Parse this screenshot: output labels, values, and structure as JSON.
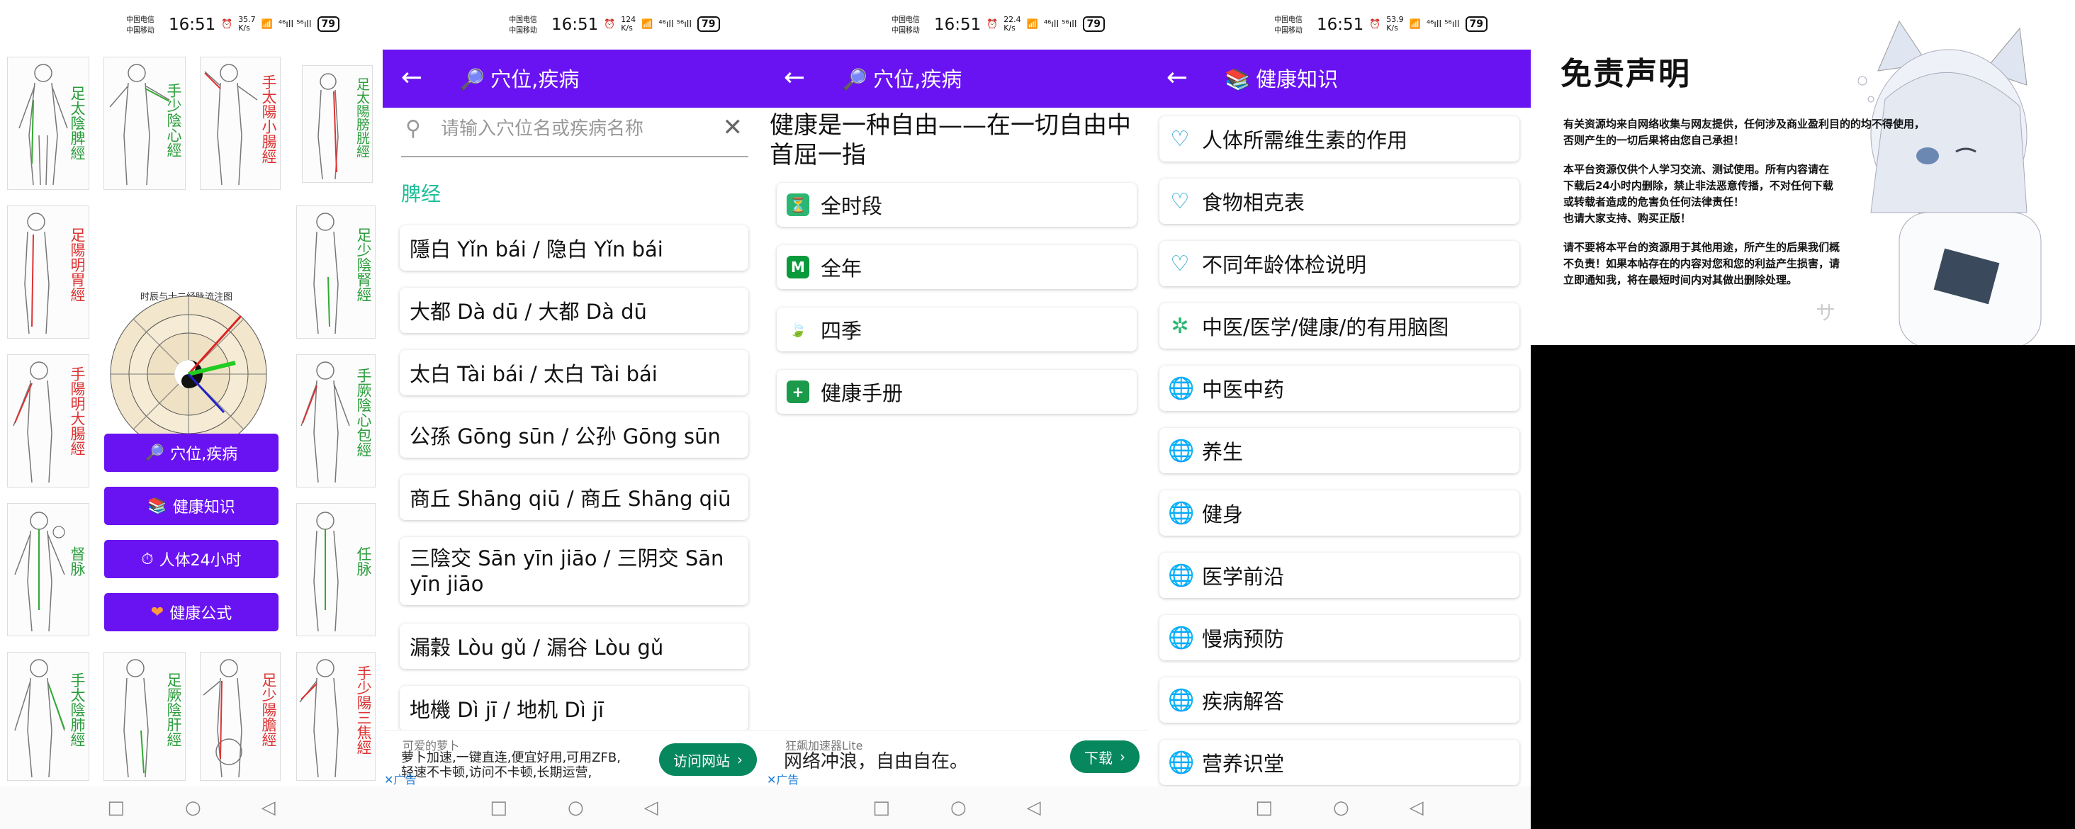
{
  "status": {
    "carrier1": "中国电信",
    "carrier2": "中国移动",
    "time": "16:51",
    "speeds": [
      "35.7\nK/s",
      "124\nK/s",
      "22.4\nK/s",
      "53.9\nK/s"
    ],
    "signal": "⁴⁶ıll ⁵⁶ıll",
    "battery": "79"
  },
  "panel1": {
    "meridians": [
      "足太陰脾經",
      "手少陰心經",
      "手太陽小腸經",
      "足太陽膀胱經",
      "足陽明胃經",
      "足少陰腎經",
      "手陽明大腸經",
      "手厥陰心包經",
      "督脉",
      "任脉",
      "手太陰肺經",
      "足厥陰肝經",
      "足少陽膽經",
      "手少陽三焦經"
    ],
    "clock_title": "时辰与十二经脉流注图",
    "buttons": [
      "穴位,疾病",
      "健康知识",
      "人体24小时",
      "健康公式"
    ]
  },
  "panel2": {
    "title": "穴位,疾病",
    "search_placeholder": "请输入穴位名或疾病名称",
    "section": "脾经",
    "items": [
      "隱白 Yǐn bái / 隐白 Yǐn bái",
      "大都 Dà dū / 大都 Dà dū",
      "太白 Tài bái / 太白 Tài bái",
      "公孫 Gōng sūn / 公孙 Gōng sūn",
      "商丘 Shāng qiū / 商丘 Shāng qiū",
      "三陰交 Sān yīn jiāo / 三阴交 Sān yīn jiāo",
      "漏穀 Lòu gǔ / 漏谷 Lòu gǔ",
      "地機 Dì jī / 地机 Dì jī"
    ],
    "ad": {
      "title": "可爱的萝卜",
      "body": "萝卜加速,一键直连,便宜好用,可用ZFB,轻速不卡顿,访问不卡顿,长期运营,",
      "button": "访问网站",
      "tag": "广告"
    }
  },
  "panel3": {
    "title": "穴位,疾病",
    "quote": " 健康是一种自由——在一切自由中首屈一指",
    "items": [
      "全时段",
      "全年",
      "四季",
      "健康手册"
    ],
    "ad": {
      "title": "狂飙加速器Lite",
      "body": "网络冲浪，自由自在。",
      "button": "下载",
      "tag": "广告"
    }
  },
  "panel4": {
    "title": "健康知识",
    "items": [
      "人体所需维生素的作用",
      "食物相克表",
      "不同年龄体检说明",
      "中医/医学/健康/的有用脑图",
      "中医中药",
      "养生",
      "健身",
      "医学前沿",
      "慢病预防",
      "疾病解答",
      "营养识堂"
    ]
  },
  "disclaimer": {
    "title": "免责声明",
    "paragraphs": [
      "有关资源均来自网络收集与网友提供，任何涉及商业盈利目的的均不得使用，\n否则产生的一切后果将由您自己承担！",
      "本平台资源仅供个人学习交流、测试使用。所有内容请在\n下载后24小时内删除，禁止非法恶意传播，不对任何下载\n或转载者造成的危害负任何法律责任！\n也请大家支持、购买正版！",
      "请不要将本平台的资源用于其他用途，所产生的后果我们概\n不负责！如果本帖存在的内容对您和您的利益产生损害，请\n立即通知我，将在最短时间内对其做出删除处理。"
    ],
    "sign": "サ"
  },
  "colors": {
    "appbar": "#6a13f2",
    "accent_green": "#1fbf9a",
    "ad_button": "#07875e"
  }
}
